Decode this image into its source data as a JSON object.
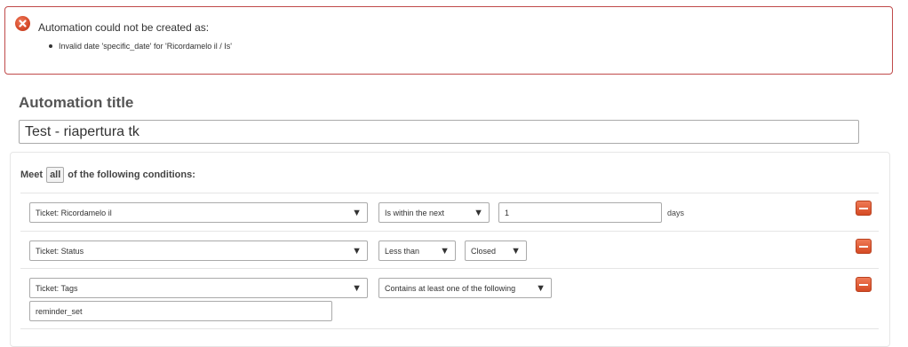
{
  "error": {
    "icon": "error-circle-x-icon",
    "title": "Automation could not be created as:",
    "items": [
      "Invalid date 'specific_date' for 'Ricordamelo il / Is'"
    ]
  },
  "form": {
    "title_label": "Automation title",
    "title_value": "Test - riapertura tk"
  },
  "conditions": {
    "meet_prefix": "Meet",
    "meet_value": "all",
    "meet_suffix": "of the following conditions:",
    "rows": [
      {
        "field": "Ticket: Ricordamelo il",
        "operator": "Is within the next",
        "value": "1",
        "unit": "days"
      },
      {
        "field": "Ticket: Status",
        "operator": "Less than",
        "value": "Closed"
      },
      {
        "field": "Ticket: Tags",
        "operator": "Contains at least one of the following",
        "value": "reminder_set"
      }
    ],
    "dropdown_arrow": "▼",
    "remove_icon": "minus-icon"
  }
}
